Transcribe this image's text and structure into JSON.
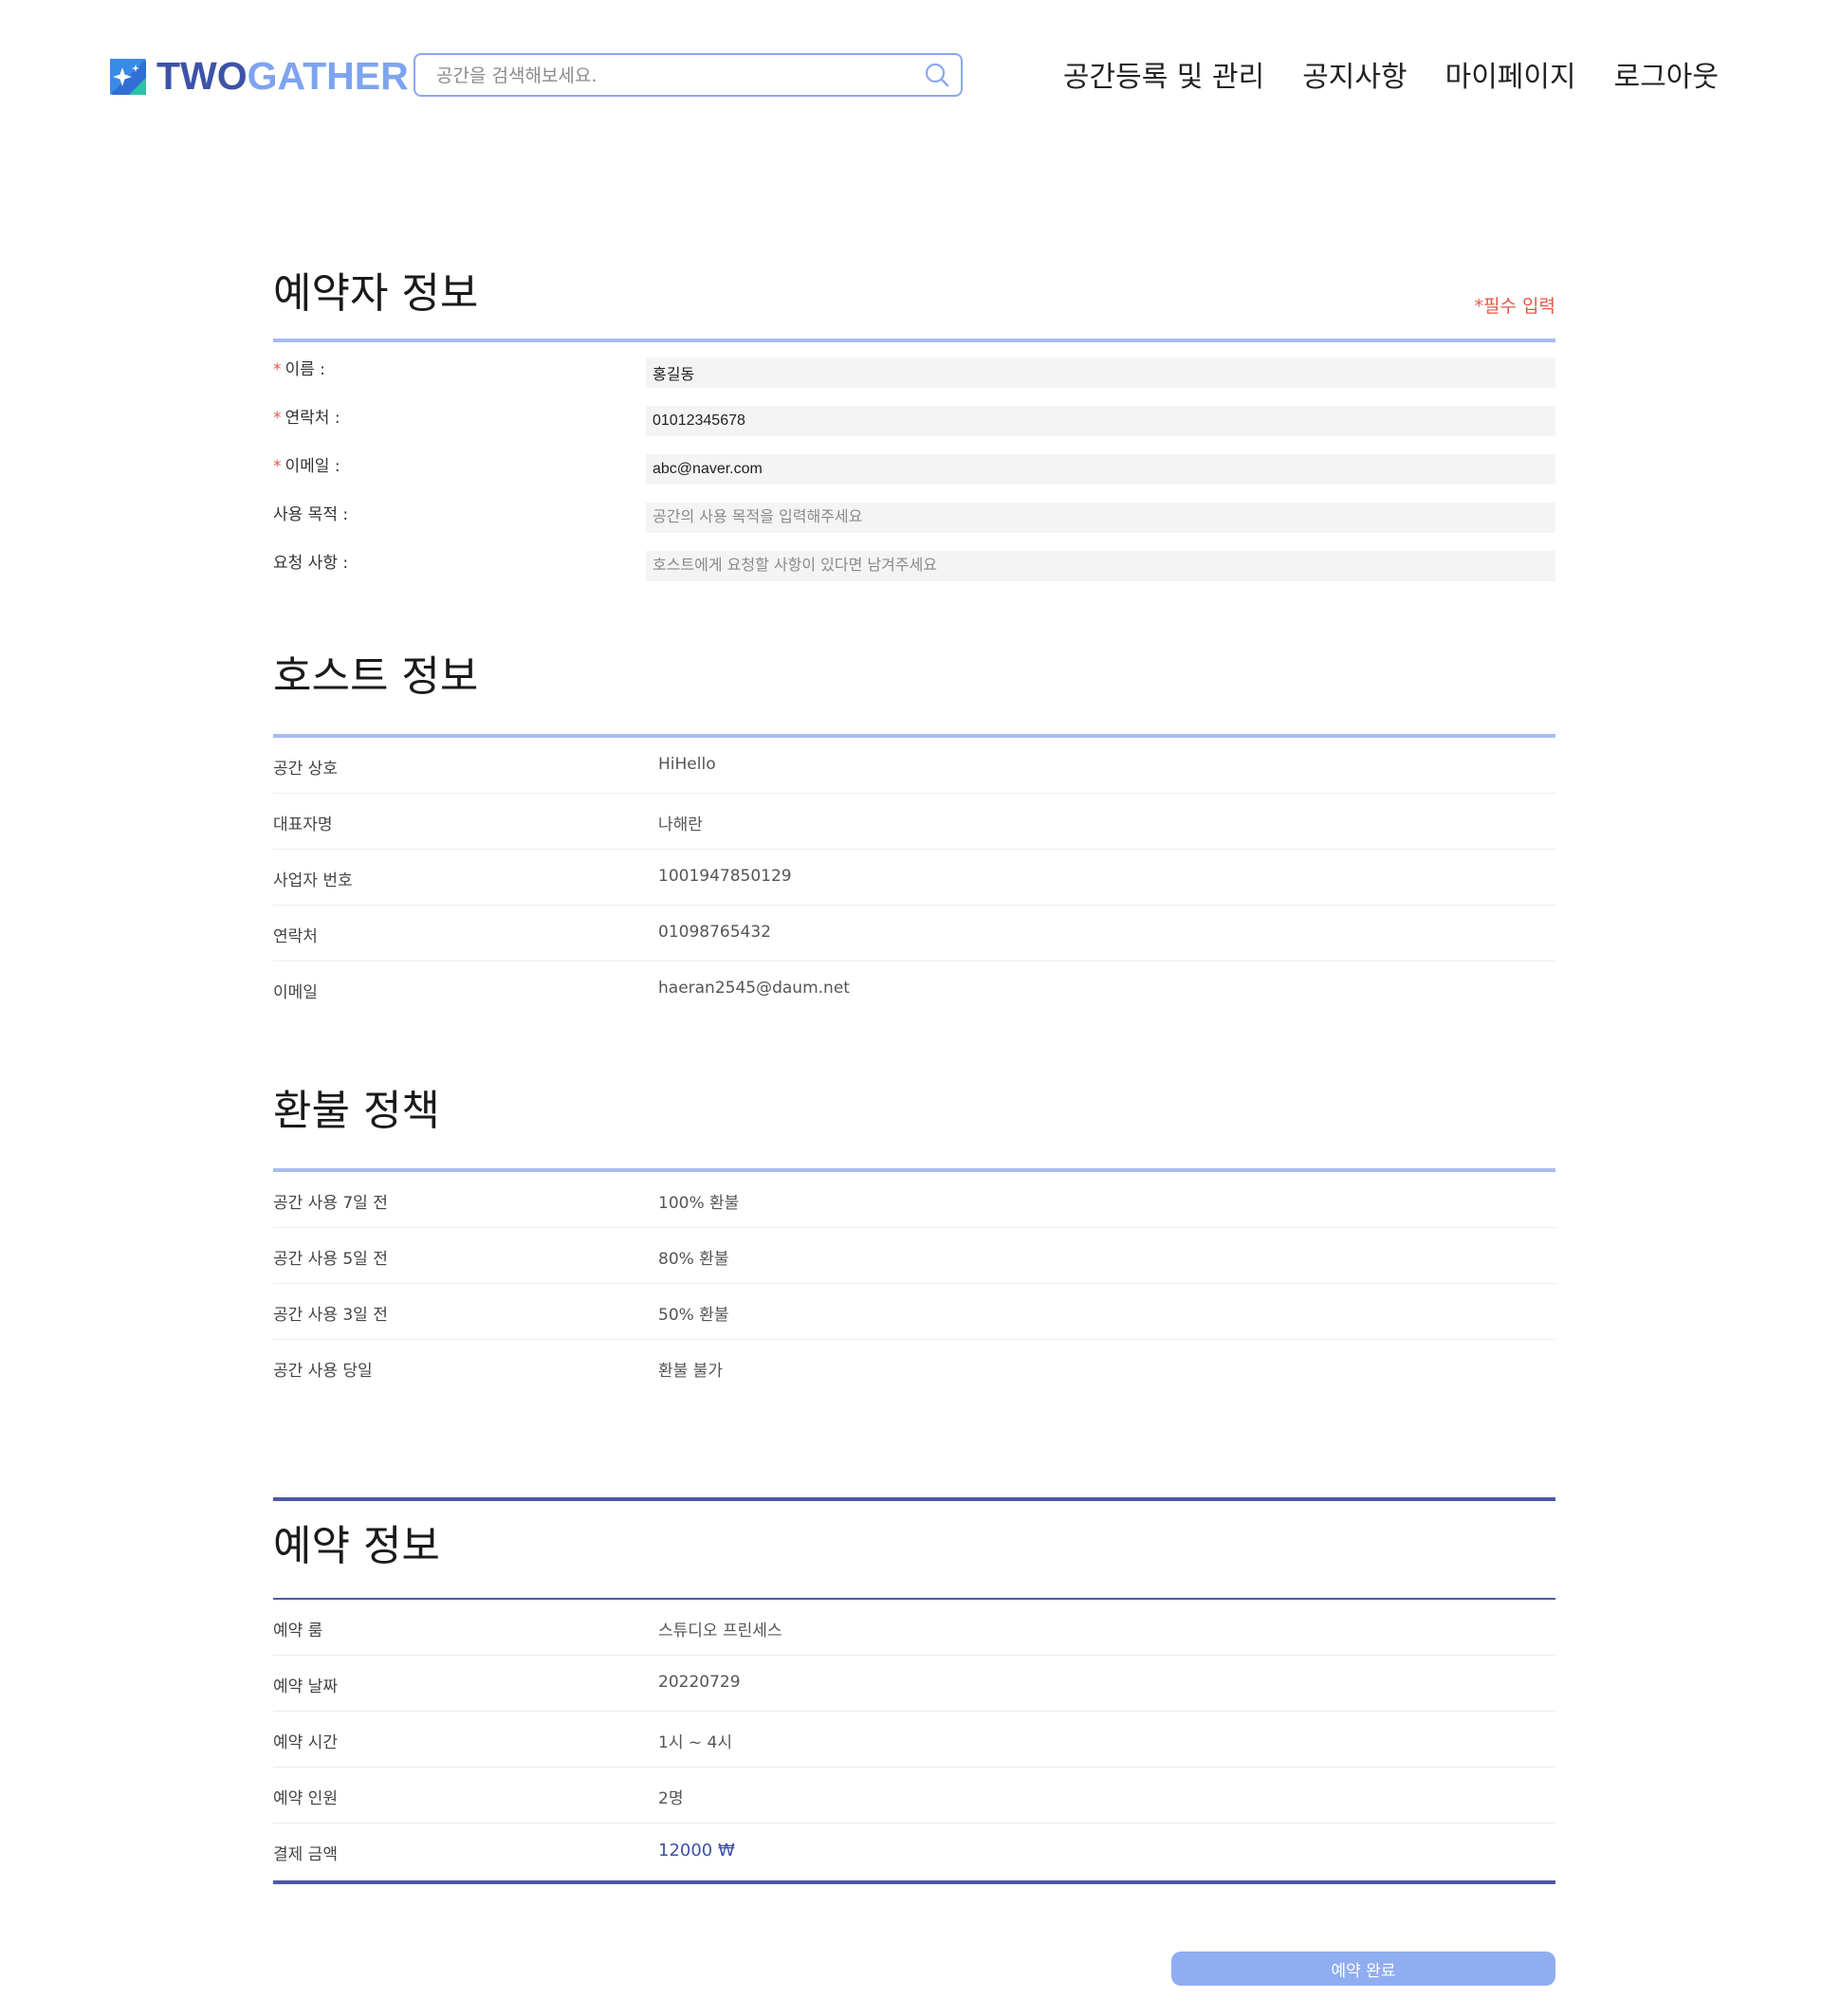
{
  "header": {
    "logo_part1": "TWO",
    "logo_part2": "GATHER",
    "search_placeholder": "공간을 검색해보세요.",
    "nav": [
      "공간등록 및 관리",
      "공지사항",
      "마이페이지",
      "로그아웃"
    ]
  },
  "booker": {
    "title": "예약자 정보",
    "required_note": "*필수 입력",
    "fields": [
      {
        "label": "이름 :",
        "required": true,
        "value": "홍길동",
        "placeholder": ""
      },
      {
        "label": "연락처 :",
        "required": true,
        "value": "01012345678",
        "placeholder": ""
      },
      {
        "label": "이메일 :",
        "required": true,
        "value": "abc@naver.com",
        "placeholder": ""
      },
      {
        "label": "사용 목적 :",
        "required": false,
        "value": "",
        "placeholder": "공간의 사용 목적을 입력해주세요"
      },
      {
        "label": "요청 사항 :",
        "required": false,
        "value": "",
        "placeholder": "호스트에게 요청할 사항이 있다면 남겨주세요"
      }
    ]
  },
  "host": {
    "title": "호스트 정보",
    "rows": [
      {
        "label": "공간 상호",
        "value": "HiHello"
      },
      {
        "label": "대표자명",
        "value": "나해란"
      },
      {
        "label": "사업자 번호",
        "value": "1001947850129"
      },
      {
        "label": "연락처",
        "value": "01098765432"
      },
      {
        "label": "이메일",
        "value": "haeran2545@daum.net"
      }
    ]
  },
  "refund": {
    "title": "환불 정책",
    "rows": [
      {
        "label": "공간 사용 7일 전",
        "value": "100% 환불"
      },
      {
        "label": "공간 사용 5일 전",
        "value": "80% 환불"
      },
      {
        "label": "공간 사용 3일 전",
        "value": "50% 환불"
      },
      {
        "label": "공간 사용 당일",
        "value": "환불 불가"
      }
    ]
  },
  "reservation": {
    "title": "예약 정보",
    "rows": [
      {
        "label": "예약 룸",
        "value": "스튜디오 프린세스"
      },
      {
        "label": "예약 날짜",
        "value": "20220729"
      },
      {
        "label": "예약 시간",
        "value": "1시 ~ 4시"
      },
      {
        "label": "예약 인원",
        "value": "2명"
      },
      {
        "label": "결제 금액",
        "value": "12000 ₩"
      }
    ]
  },
  "submit_label": "예약 완료",
  "colors": {
    "brand_dark": "#3d52a8",
    "brand_light": "#7ea4ef",
    "required": "#e05a4a",
    "section_bar": "#a9bcef",
    "reservation_bar": "#4e57a8",
    "button": "#8fadf0"
  }
}
